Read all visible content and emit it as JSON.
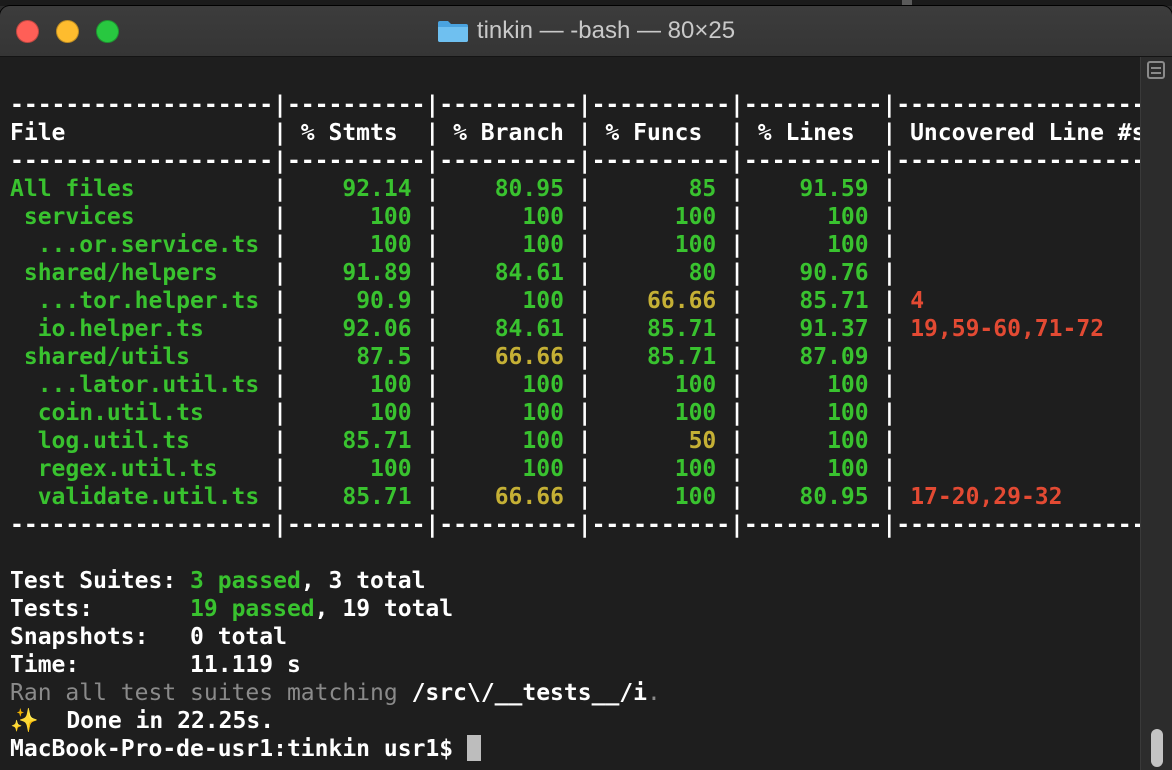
{
  "window": {
    "title": "tinkin — -bash — 80×25"
  },
  "icons": {
    "folder": "folder-icon",
    "split": "split-pane-icon"
  },
  "colors": {
    "green": "#39c22f",
    "yellow": "#c5b035",
    "red": "#e34a33",
    "background": "#1e1e1e"
  },
  "coverage": {
    "separator": "-------------------|----------|----------|----------|----------|-------------------",
    "header": "File               | % Stmts  | % Branch | % Funcs  | % Lines  | Uncovered Line #s",
    "rows": [
      {
        "file": "All files",
        "stmts": "92.14",
        "branch": "80.95",
        "funcs": "85",
        "lines": "91.59",
        "uncovered": ""
      },
      {
        "file": " services",
        "stmts": "100",
        "branch": "100",
        "funcs": "100",
        "lines": "100",
        "uncovered": ""
      },
      {
        "file": "  ...or.service.ts",
        "stmts": "100",
        "branch": "100",
        "funcs": "100",
        "lines": "100",
        "uncovered": ""
      },
      {
        "file": " shared/helpers",
        "stmts": "91.89",
        "branch": "84.61",
        "funcs": "80",
        "lines": "90.76",
        "uncovered": ""
      },
      {
        "file": "  ...tor.helper.ts",
        "stmts": "90.9",
        "branch": "100",
        "funcs": "66.66",
        "lines": "85.71",
        "uncovered": "4"
      },
      {
        "file": "  io.helper.ts",
        "stmts": "92.06",
        "branch": "84.61",
        "funcs": "85.71",
        "lines": "91.37",
        "uncovered": "19,59-60,71-72"
      },
      {
        "file": " shared/utils",
        "stmts": "87.5",
        "branch": "66.66",
        "funcs": "85.71",
        "lines": "87.09",
        "uncovered": ""
      },
      {
        "file": "  ...lator.util.ts",
        "stmts": "100",
        "branch": "100",
        "funcs": "100",
        "lines": "100",
        "uncovered": ""
      },
      {
        "file": "  coin.util.ts",
        "stmts": "100",
        "branch": "100",
        "funcs": "100",
        "lines": "100",
        "uncovered": ""
      },
      {
        "file": "  log.util.ts",
        "stmts": "85.71",
        "branch": "100",
        "funcs": "50",
        "lines": "100",
        "uncovered": ""
      },
      {
        "file": "  regex.util.ts",
        "stmts": "100",
        "branch": "100",
        "funcs": "100",
        "lines": "100",
        "uncovered": ""
      },
      {
        "file": "  validate.util.ts",
        "stmts": "85.71",
        "branch": "66.66",
        "funcs": "100",
        "lines": "80.95",
        "uncovered": "17-20,29-32"
      }
    ]
  },
  "summary": {
    "suites_label": "Test Suites:",
    "suites_passed": "3 passed",
    "suites_total": ", 3 total",
    "tests_label": "Tests:",
    "tests_passed": "19 passed",
    "tests_total": ", 19 total",
    "snapshots_label": "Snapshots:",
    "snapshots_value": "0 total",
    "time_label": "Time:",
    "time_value": "11.119 s",
    "ran_label": "Ran all test suites matching",
    "ran_pattern": " /src\\/__tests__/i",
    "ran_dot": ".",
    "done_icon": "✨",
    "done_text": "  Done in 22.25s."
  },
  "prompt": {
    "text": "MacBook-Pro-de-usr1:tinkin usr1$ "
  }
}
